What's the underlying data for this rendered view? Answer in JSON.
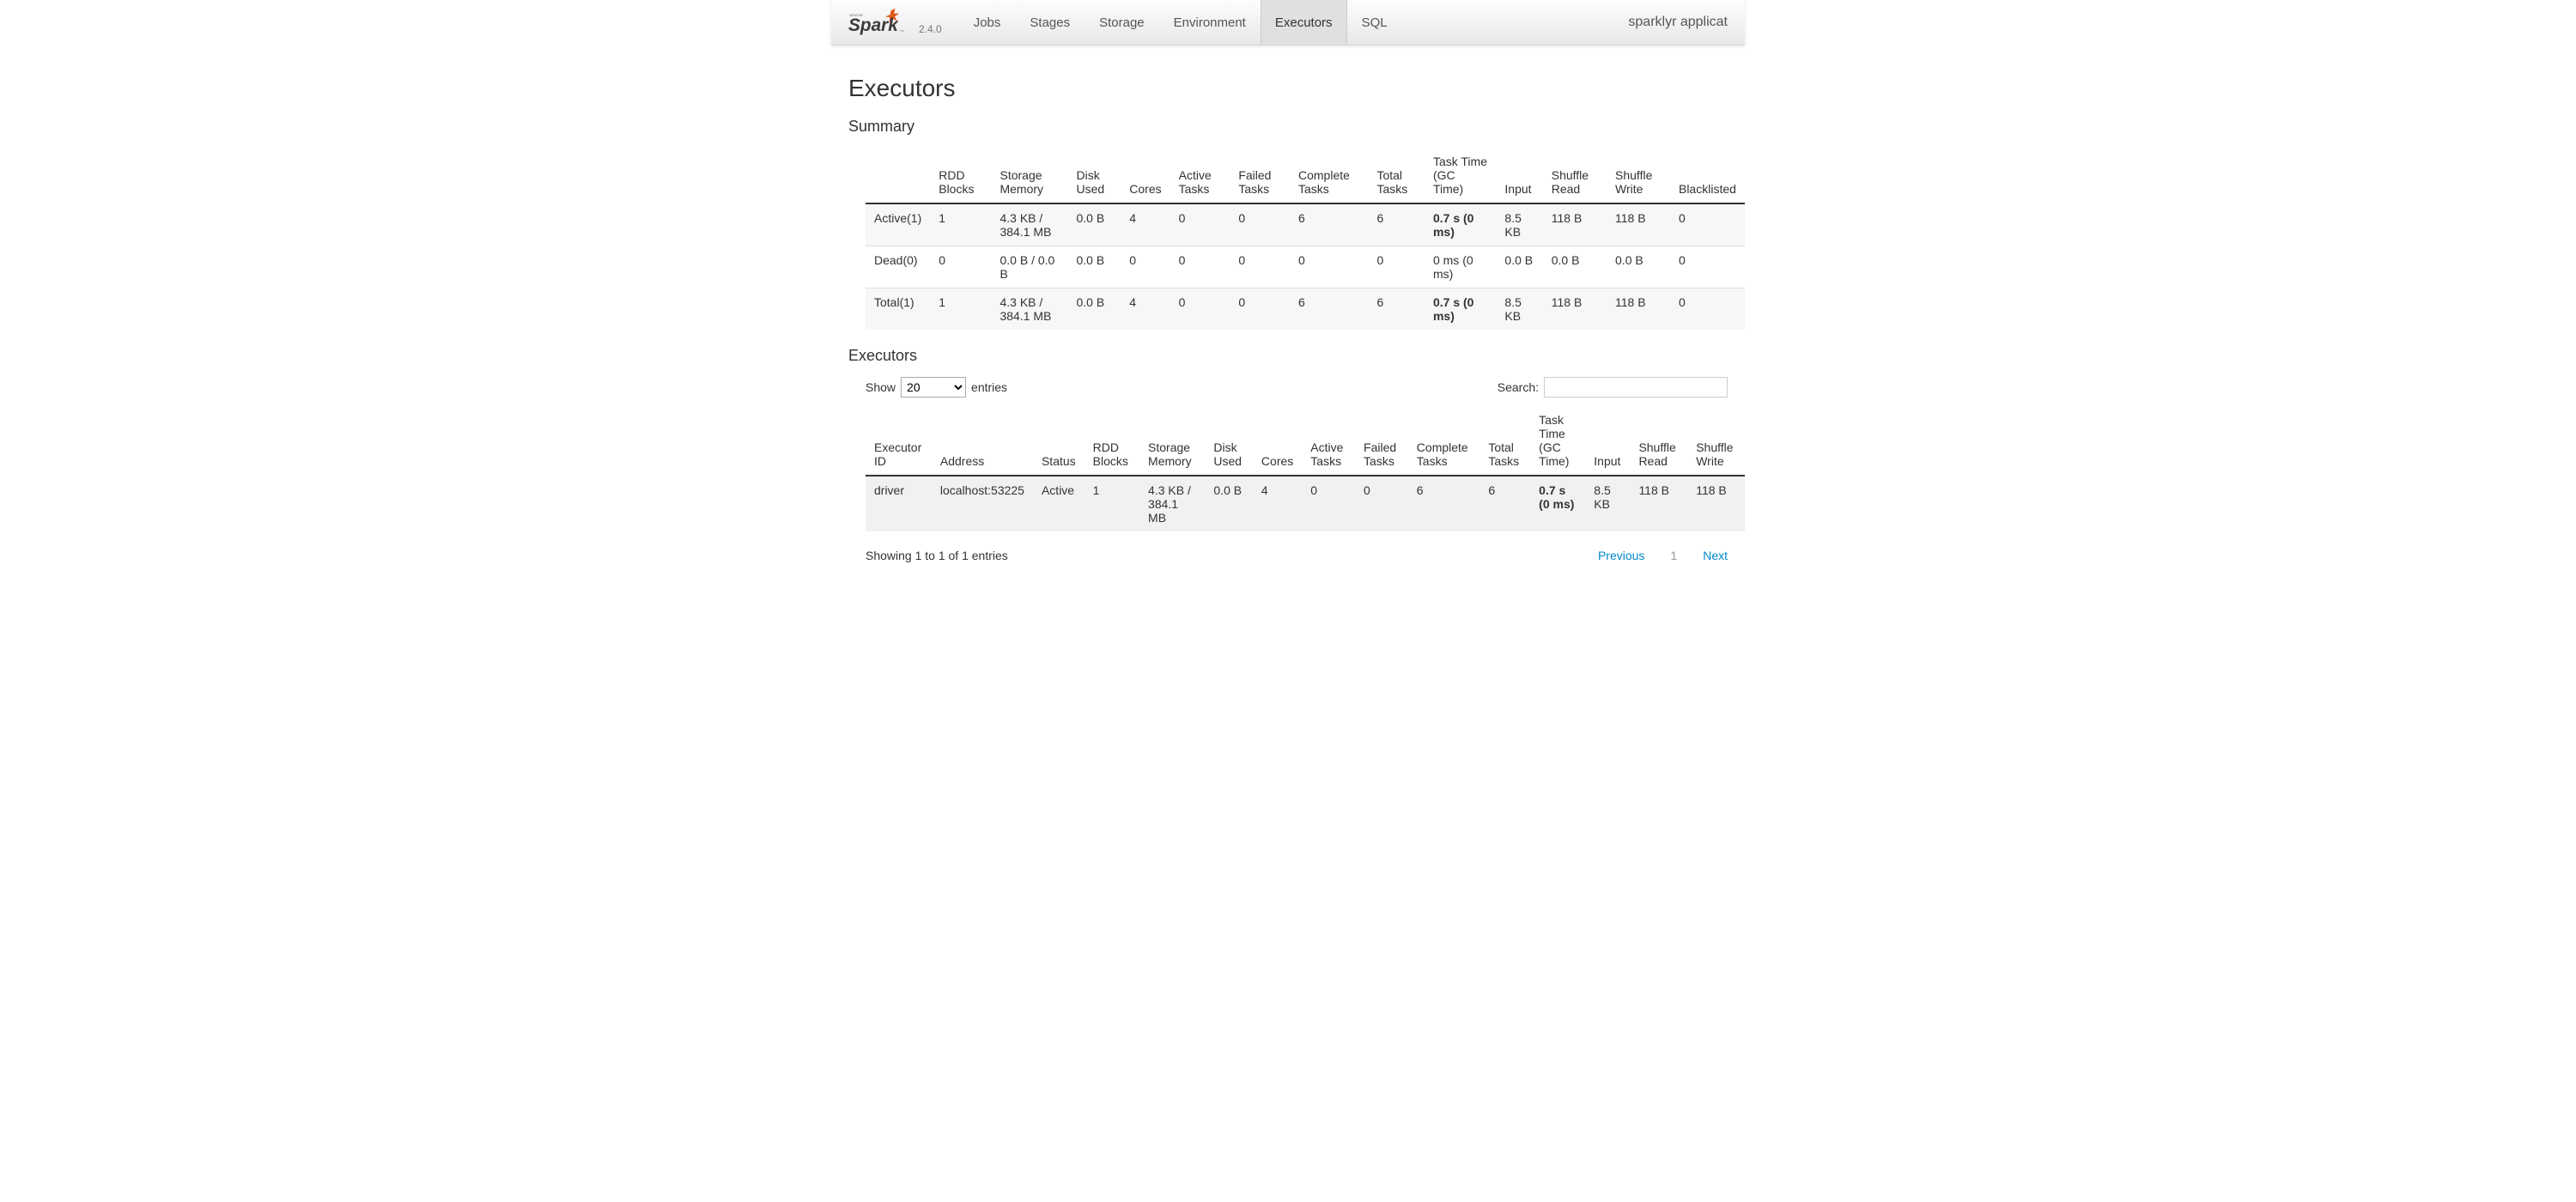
{
  "header": {
    "version": "2.4.0",
    "tabs": [
      "Jobs",
      "Stages",
      "Storage",
      "Environment",
      "Executors",
      "SQL"
    ],
    "active_tab": "Executors",
    "app_name": "sparklyr applicat"
  },
  "page_title": "Executors",
  "summary": {
    "title": "Summary",
    "columns": [
      "",
      "RDD Blocks",
      "Storage Memory",
      "Disk Used",
      "Cores",
      "Active Tasks",
      "Failed Tasks",
      "Complete Tasks",
      "Total Tasks",
      "Task Time (GC Time)",
      "Input",
      "Shuffle Read",
      "Shuffle Write",
      "Blacklisted"
    ],
    "rows": [
      {
        "label": "Active(1)",
        "rdd": "1",
        "mem": "4.3 KB / 384.1 MB",
        "disk": "0.0 B",
        "cores": "4",
        "active": "0",
        "failed": "0",
        "complete": "6",
        "total": "6",
        "tasktime": "0.7 s (0 ms)",
        "input": "8.5 KB",
        "sread": "118 B",
        "swrite": "118 B",
        "black": "0"
      },
      {
        "label": "Dead(0)",
        "rdd": "0",
        "mem": "0.0 B / 0.0 B",
        "disk": "0.0 B",
        "cores": "0",
        "active": "0",
        "failed": "0",
        "complete": "0",
        "total": "0",
        "tasktime": "0 ms (0 ms)",
        "input": "0.0 B",
        "sread": "0.0 B",
        "swrite": "0.0 B",
        "black": "0"
      },
      {
        "label": "Total(1)",
        "rdd": "1",
        "mem": "4.3 KB / 384.1 MB",
        "disk": "0.0 B",
        "cores": "4",
        "active": "0",
        "failed": "0",
        "complete": "6",
        "total": "6",
        "tasktime": "0.7 s (0 ms)",
        "input": "8.5 KB",
        "sread": "118 B",
        "swrite": "118 B",
        "black": "0"
      }
    ]
  },
  "executors": {
    "title": "Executors",
    "show_label_pre": "Show",
    "show_label_post": "entries",
    "show_value": "20",
    "search_label": "Search:",
    "columns": [
      "Executor ID",
      "Address",
      "Status",
      "RDD Blocks",
      "Storage Memory",
      "Disk Used",
      "Cores",
      "Active Tasks",
      "Failed Tasks",
      "Complete Tasks",
      "Total Tasks",
      "Task Time (GC Time)",
      "Input",
      "Shuffle Read",
      "Shuffle Write"
    ],
    "rows": [
      {
        "id": "driver",
        "addr": "localhost:53225",
        "status": "Active",
        "rdd": "1",
        "mem": "4.3 KB / 384.1 MB",
        "disk": "0.0 B",
        "cores": "4",
        "active": "0",
        "failed": "0",
        "complete": "6",
        "total": "6",
        "tasktime": "0.7 s (0 ms)",
        "input": "8.5 KB",
        "sread": "118 B",
        "swrite": "118 B"
      }
    ],
    "info_text": "Showing 1 to 1 of 1 entries",
    "prev_label": "Previous",
    "next_label": "Next",
    "page_num": "1"
  }
}
